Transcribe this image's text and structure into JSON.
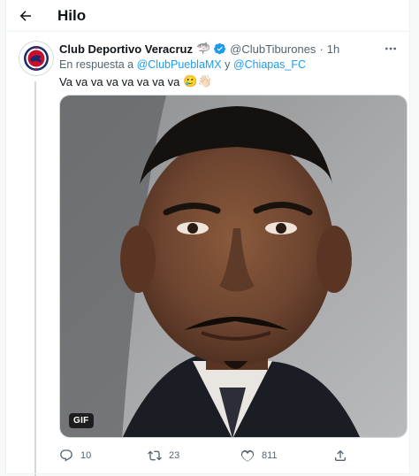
{
  "header": {
    "back_icon": "arrow-left-icon",
    "title": "Hilo"
  },
  "tweet": {
    "avatar_icon": "club-crest-icon",
    "author_name": "Club Deportivo Veracruz",
    "author_emoji": "🦈",
    "verified_icon": "verified-badge-icon",
    "handle": "@ClubTiburones",
    "separator": "·",
    "time": "1h",
    "reply_prefix": "En respuesta a",
    "reply_mention_1": "@ClubPueblaMX",
    "reply_conjunction": "y",
    "reply_mention_2": "@Chiapas_FC",
    "text": "Va va va va va va va va",
    "text_emojis": "🥲👋🏻",
    "media": {
      "type": "gif",
      "badge": "GIF"
    },
    "actions": {
      "reply_count": "10",
      "retweet_count": "23",
      "like_count": "811"
    }
  },
  "colors": {
    "accent": "#1d9bf0",
    "text_primary": "#0f1419",
    "text_secondary": "#536471",
    "border": "#eff3f4"
  }
}
